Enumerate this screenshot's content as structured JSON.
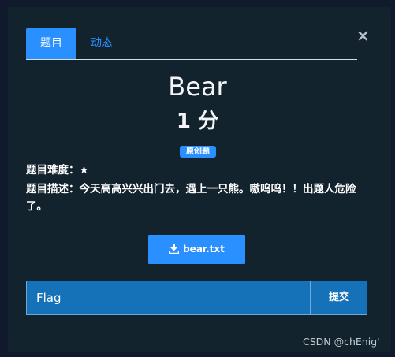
{
  "tabs": [
    {
      "label": "题目"
    },
    {
      "label": "动态"
    }
  ],
  "close_symbol": "×",
  "challenge": {
    "name": "Bear",
    "points": "1 分",
    "tag": "原创题",
    "difficulty_label": "题目难度：",
    "difficulty_value": "★",
    "description_label": "题目描述：",
    "description_text": "今天高高兴兴出门去，遇上一只熊。嗷呜呜！！出题人危险了。"
  },
  "download": {
    "file_name": "bear.txt",
    "icon": "download-icon"
  },
  "flag_form": {
    "placeholder": "Flag",
    "submit_label": "提交"
  },
  "watermark": "CSDN @chEnig'",
  "colors": {
    "accent": "#2a8fff",
    "modal_background": "#13232e",
    "input_background": "#1572b9"
  }
}
